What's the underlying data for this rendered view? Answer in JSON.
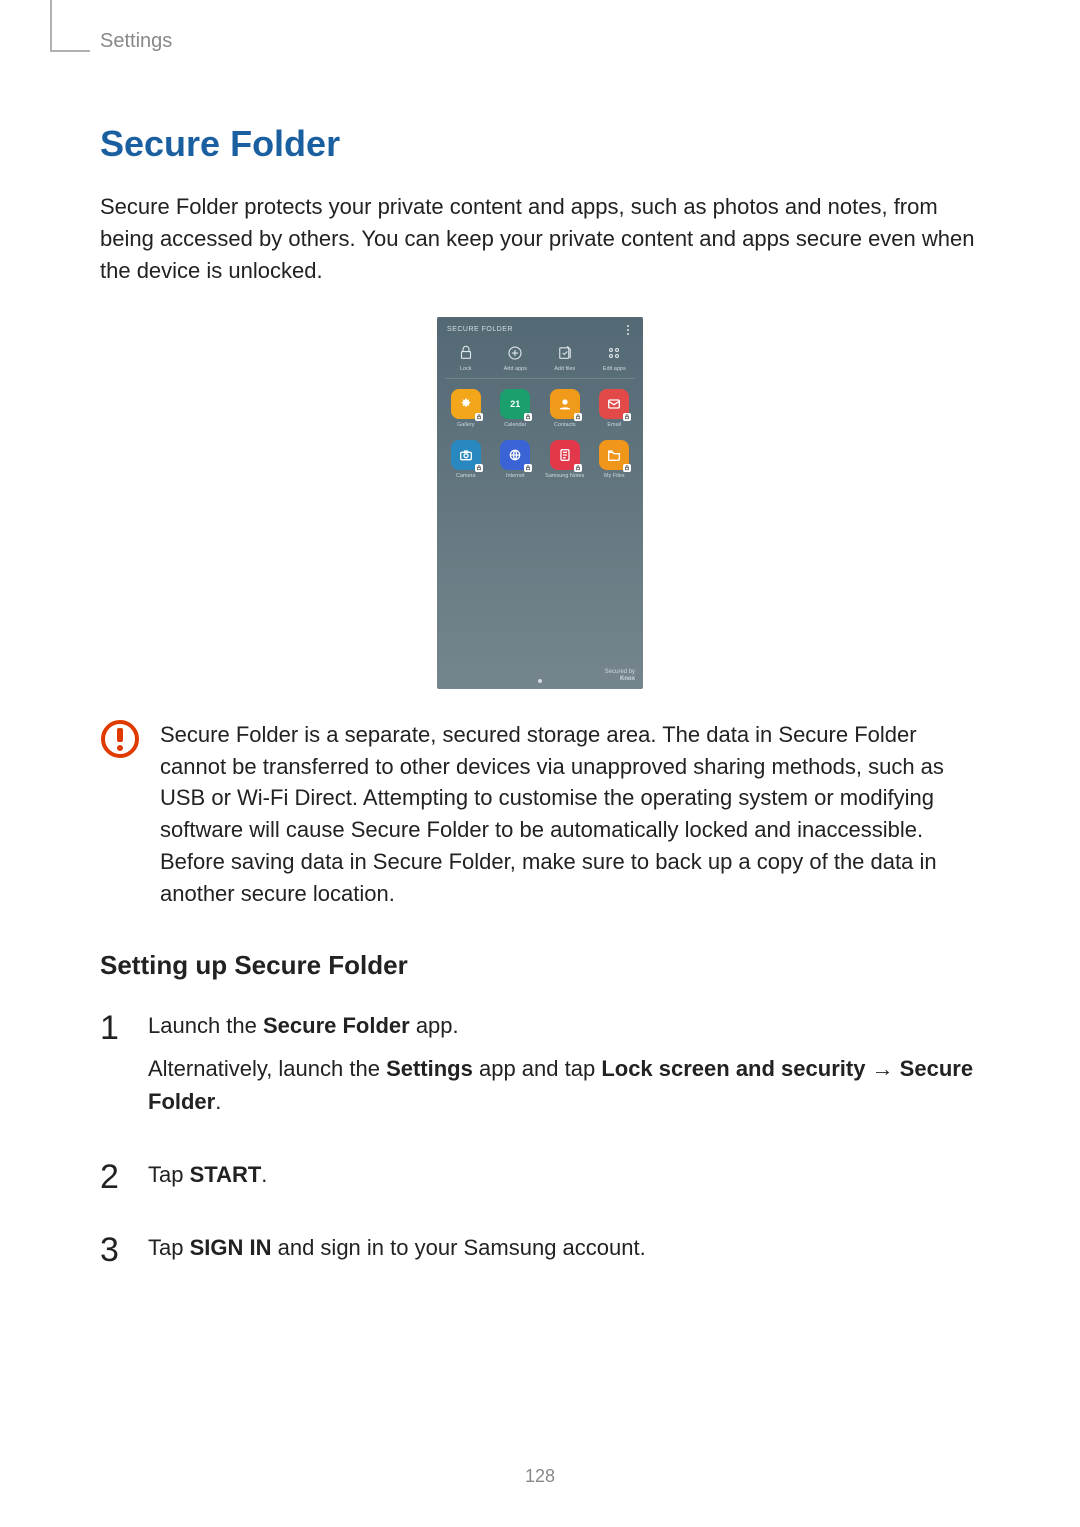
{
  "breadcrumb": "Settings",
  "title": "Secure Folder",
  "intro": "Secure Folder protects your private content and apps, such as photos and notes, from being accessed by others. You can keep your private content and apps secure even when the device is unlocked.",
  "phone": {
    "header": "SECURE FOLDER",
    "tools": [
      {
        "icon": "lock-icon",
        "label": "Lock"
      },
      {
        "icon": "plus-circle-icon",
        "label": "Add apps"
      },
      {
        "icon": "add-files-icon",
        "label": "Add files"
      },
      {
        "icon": "apps-grid-icon",
        "label": "Edit apps"
      }
    ],
    "apps_row1": [
      {
        "icon": "gallery",
        "label": "Gallery"
      },
      {
        "icon": "calendar",
        "label": "Calendar",
        "text": "21"
      },
      {
        "icon": "contacts",
        "label": "Contacts"
      },
      {
        "icon": "email",
        "label": "Email"
      }
    ],
    "apps_row2": [
      {
        "icon": "camera",
        "label": "Camera"
      },
      {
        "icon": "internet",
        "label": "Internet"
      },
      {
        "icon": "notes",
        "label": "Samsung Notes"
      },
      {
        "icon": "files",
        "label": "My Files"
      }
    ],
    "knox_top": "Secured by",
    "knox_bottom": "Knox"
  },
  "warning": "Secure Folder is a separate, secured storage area. The data in Secure Folder cannot be transferred to other devices via unapproved sharing methods, such as USB or Wi-Fi Direct. Attempting to customise the operating system or modifying software will cause Secure Folder to be automatically locked and inaccessible. Before saving data in Secure Folder, make sure to back up a copy of the data in another secure location.",
  "subheading": "Setting up Secure Folder",
  "steps": {
    "s1_num": "1",
    "s1_a_pre": "Launch the ",
    "s1_a_bold": "Secure Folder",
    "s1_a_post": " app.",
    "s1_b_pre": "Alternatively, launch the ",
    "s1_b_b1": "Settings",
    "s1_b_mid": " app and tap ",
    "s1_b_b2": "Lock screen and security",
    "s1_b_arrow": " → ",
    "s1_b_b3": "Secure Folder",
    "s1_b_post": ".",
    "s2_num": "2",
    "s2_pre": "Tap ",
    "s2_bold": "START",
    "s2_post": ".",
    "s3_num": "3",
    "s3_pre": "Tap ",
    "s3_bold": "SIGN IN",
    "s3_post": " and sign in to your Samsung account."
  },
  "page_number": "128"
}
